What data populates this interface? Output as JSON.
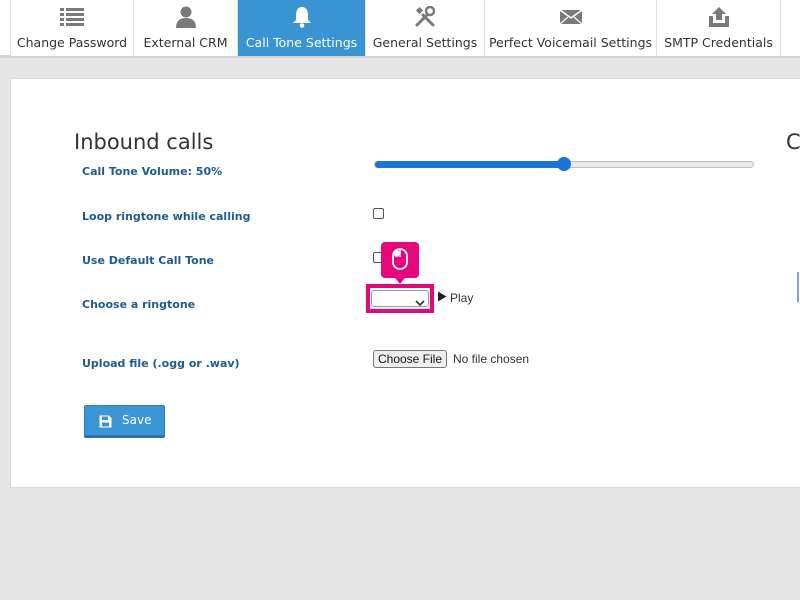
{
  "tabs": [
    {
      "label": "Change Password",
      "icon": "list-icon"
    },
    {
      "label": "External CRM",
      "icon": "user-icon"
    },
    {
      "label": "Call Tone Settings",
      "icon": "bell-icon",
      "active": true
    },
    {
      "label": "General Settings",
      "icon": "tools-icon"
    },
    {
      "label": "Perfect Voicemail Settings",
      "icon": "envelope-icon"
    },
    {
      "label": "SMTP Credentials",
      "icon": "upload-icon"
    },
    {
      "label": "",
      "icon": ""
    }
  ],
  "inbound": {
    "title": "Inbound calls",
    "volume_label": "Call Tone Volume: 50%",
    "volume_value": 0.5,
    "loop_label": "Loop ringtone while calling",
    "loop_checked": false,
    "default_label": "Use Default Call Tone",
    "default_checked": false,
    "ringtone_label": "Choose a ringtone",
    "ringtone_selected": "",
    "play_label": "Play",
    "upload_label": "Upload file (.ogg or .wav)",
    "choose_file_label": "Choose File",
    "file_status": "No file chosen",
    "save_label": "Save"
  },
  "outbound_partial": {
    "title": "C"
  },
  "colors": {
    "accent": "#3a93d2",
    "label": "#1f5b8f",
    "highlight": "#e5077b",
    "slider": "#1c73d8"
  }
}
